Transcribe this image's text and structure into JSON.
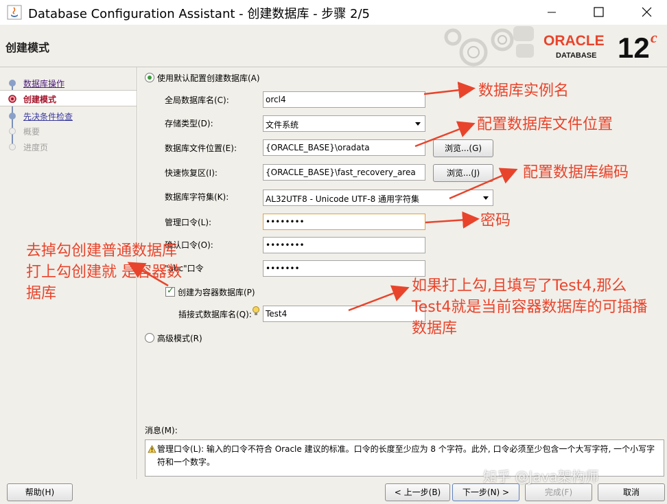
{
  "window": {
    "title": "Database Configuration Assistant - 创建数据库 - 步骤 2/5",
    "controls": [
      "minimize",
      "maximize",
      "close"
    ]
  },
  "header": {
    "title": "创建模式",
    "logo_brand": "ORACLE",
    "logo_product": "DATABASE",
    "logo_version": "12",
    "logo_version_suffix": "c"
  },
  "sidebar": {
    "steps": [
      {
        "label": "数据库操作",
        "state": "link"
      },
      {
        "label": "创建模式",
        "state": "active"
      },
      {
        "label": "先决条件检查",
        "state": "link"
      },
      {
        "label": "概要",
        "state": "disabled"
      },
      {
        "label": "进度页",
        "state": "disabled"
      }
    ]
  },
  "form": {
    "default_mode_label": "使用默认配置创建数据库(A)",
    "global_db_name_label": "全局数据库名(C):",
    "global_db_name_value": "orcl4",
    "storage_type_label": "存储类型(D):",
    "storage_type_value": "文件系统",
    "db_file_location_label": "数据库文件位置(E):",
    "db_file_location_value": "{ORACLE_BASE}\\oradata",
    "browse_g_label": "浏览...(G)",
    "fast_recovery_label": "快速恢复区(I):",
    "fast_recovery_value": "{ORACLE_BASE}\\fast_recovery_area",
    "browse_j_label": "浏览...(J)",
    "charset_label": "数据库字符集(K):",
    "charset_value": "AL32UTF8 - Unicode UTF-8 通用字符集",
    "admin_password_label": "管理口令(L):",
    "admin_password_value": "••••••••",
    "confirm_password_label": "确认口令(O):",
    "confirm_password_value": "••••••••",
    "abc_password_label": "\"abc\"口令",
    "abc_password_value": "•••••••",
    "container_db_label": "创建为容器数据库(P)",
    "container_db_checked": true,
    "pluggable_db_label": "插接式数据库名(Q):",
    "pluggable_db_value": "Test4",
    "advanced_mode_label": "高级模式(R)"
  },
  "messages": {
    "label": "消息(M):",
    "text": "管理口令(L): 输入的口令不符合 Oracle 建议的标准。口令的长度至少应为 8 个字符。此外, 口令必须至少包含一个大写字符, 一个小写字符和一个数字。"
  },
  "footer": {
    "help_label": "帮助(H)",
    "back_label": "< 上一步(B)",
    "next_label": "下一步(N) >",
    "finish_label": "完成(F)",
    "cancel_label": "取消"
  },
  "annotations": {
    "db_instance_name": "数据库实例名",
    "db_file_location": "配置数据库文件位置",
    "db_encoding": "配置数据库编码",
    "password": "密码",
    "container_note": "去掉勾创建普通数据库 打上勾创建就 是容器数据库",
    "pluggable_note": "如果打上勾,且填写了Test4,那么Test4就是当前容器数据库的可插播数据库"
  },
  "watermark": "知乎 @Java架构师",
  "colors": {
    "panel_bg": "#f1efe9",
    "annotation_red": "#e8442c",
    "oracle_red": "#e8442c",
    "link_color": "#3a3aa0",
    "active_step_color": "#a3142a"
  }
}
